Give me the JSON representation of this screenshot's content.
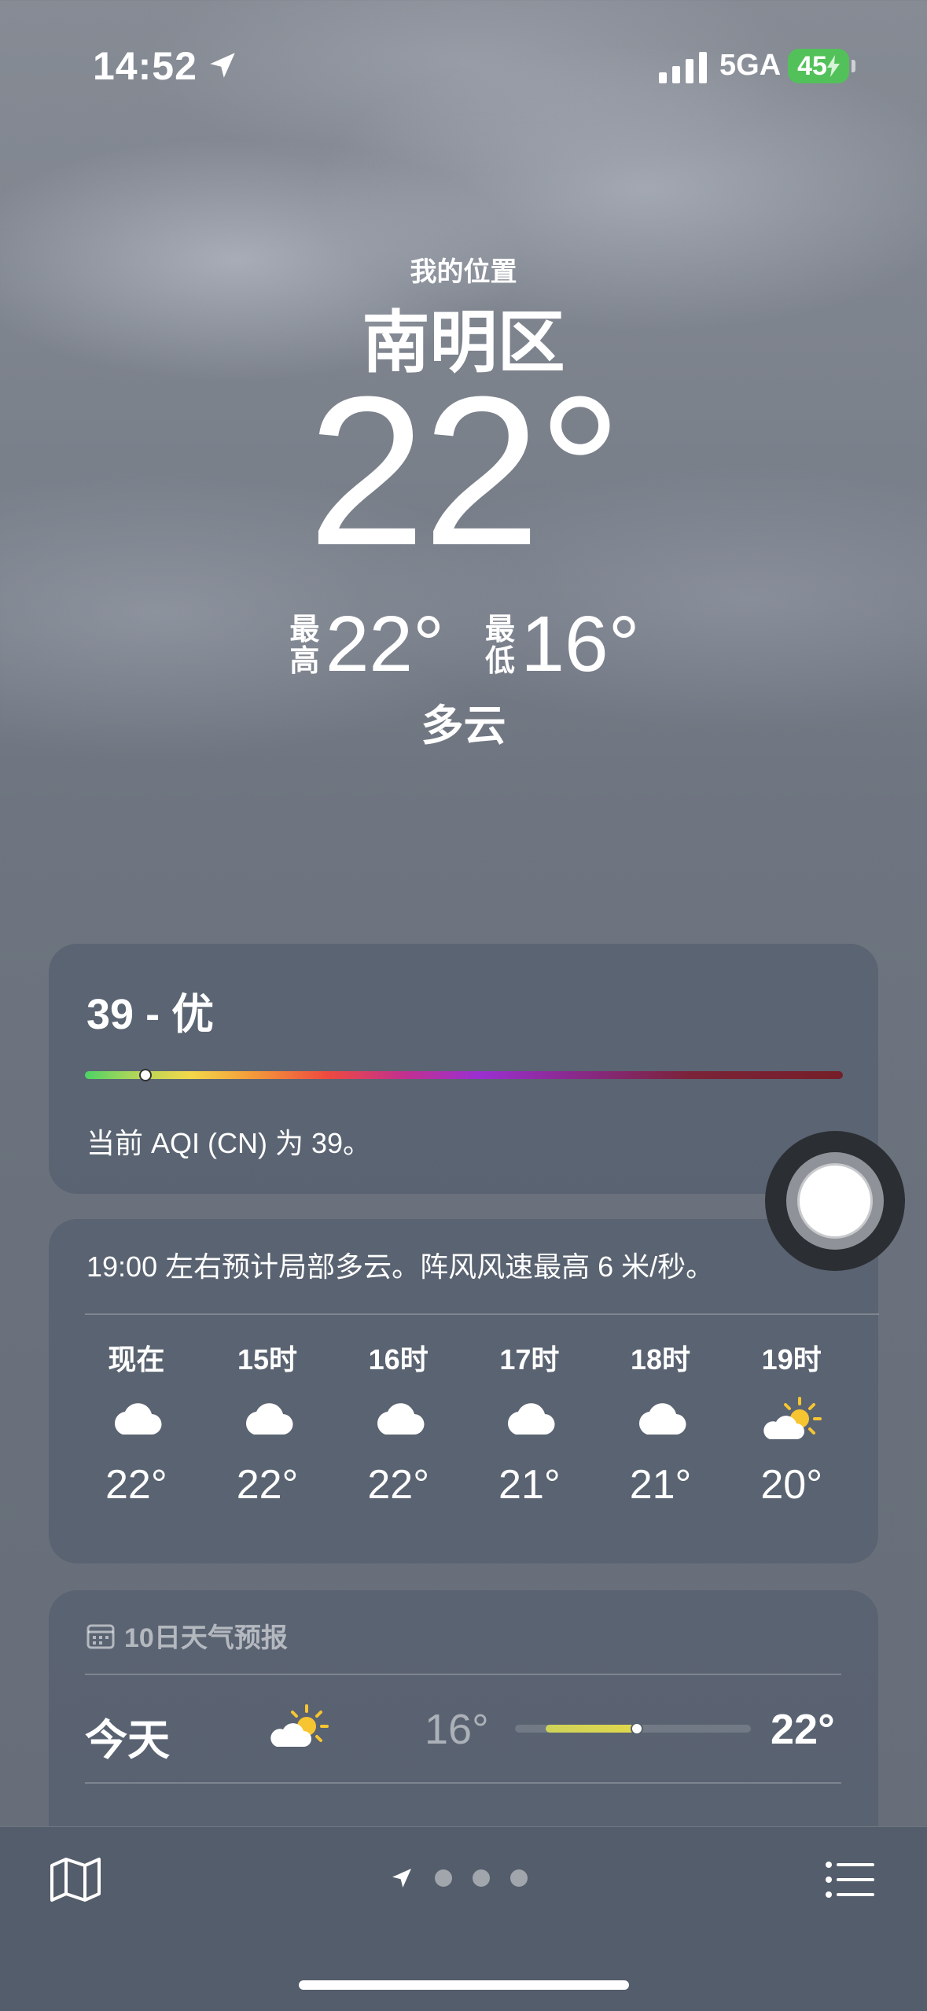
{
  "status_bar": {
    "time": "14:52",
    "network": "5GA",
    "battery": "45"
  },
  "header": {
    "my_location": "我的位置",
    "city": "南明区",
    "temperature": "22°",
    "high_label": "最高",
    "high": "22°",
    "low_label": "最低",
    "low": "16°",
    "condition": "多云"
  },
  "aqi": {
    "value_label": "39 - 优",
    "level_fraction": 0.08,
    "description": "当前 AQI (CN) 为 39。"
  },
  "hourly": {
    "summary": "19:00 左右预计局部多云。阵风风速最高 6 米/秒。",
    "hours": [
      {
        "label": "现在",
        "icon": "cloud-icon",
        "temp": "22°"
      },
      {
        "label": "15时",
        "icon": "cloud-icon",
        "temp": "22°"
      },
      {
        "label": "16时",
        "icon": "cloud-icon",
        "temp": "22°"
      },
      {
        "label": "17时",
        "icon": "cloud-icon",
        "temp": "21°"
      },
      {
        "label": "18时",
        "icon": "cloud-icon",
        "temp": "21°"
      },
      {
        "label": "19时",
        "icon": "partly-sunny-icon",
        "temp": "20°"
      }
    ]
  },
  "daily": {
    "title": "10日天气预报",
    "days": [
      {
        "name": "今天",
        "icon": "partly-sunny-icon",
        "low": "16°",
        "high": "22°"
      }
    ]
  },
  "colors": {
    "card_bg": "#545e6e",
    "battery_green": "#53c15a",
    "sun_yellow": "#f7c531"
  },
  "pager": {
    "pages": 3
  }
}
